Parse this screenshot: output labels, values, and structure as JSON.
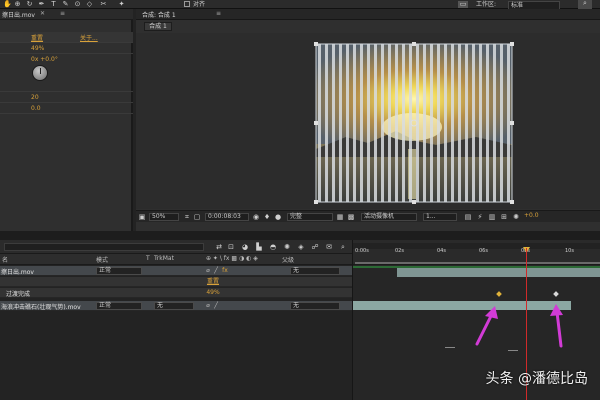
{
  "toolbar": {
    "checkbox_label": "对齐",
    "workspace_label": "工作区:",
    "workspace_value": "标准"
  },
  "effects_panel": {
    "tab_title": "擦日出.mov",
    "col_reset": "重置",
    "col_about": "关于...",
    "values": [
      "49%",
      "0x +0.0°",
      "20",
      "0.0"
    ]
  },
  "comp_panel": {
    "tab_title": "合成: 合成 1",
    "sub_tab": "合成 1",
    "zoom": "50%",
    "timecode": "0:00:08:03",
    "resolution": "完整",
    "camera": "活动摄像机",
    "views": "1...",
    "exposure": "+0.0"
  },
  "timeline": {
    "col_name": "名",
    "col_mode": "模式",
    "col_t": "T",
    "col_trkmat": "TrkMat",
    "col_parent": "父级",
    "layers": [
      {
        "name": "擦日出.mov",
        "mode": "正常",
        "trkmat": "",
        "parent": "无"
      },
      {
        "name": "",
        "mode": "",
        "trkmat": "",
        "parent": "",
        "reset": "重置",
        "value": "49%"
      },
      {
        "name": "过渡完成",
        "mode": "",
        "trkmat": "",
        "parent": ""
      },
      {
        "name": "海浪冲击礁石(壮观气势).mov",
        "mode": "正常",
        "trkmat": "无",
        "parent": "无"
      }
    ],
    "ruler_labels": [
      "0:00s",
      "02s",
      "04s",
      "06s",
      "08s",
      "10s"
    ]
  },
  "colors": {
    "accent_orange": "#d9a23a",
    "playhead": "#d02a2a",
    "layer_bar_1": "#7f9593",
    "layer_bar_2": "#8ba8a3",
    "arrow": "#d23bd6"
  },
  "watermark": "头条 @潘德比岛"
}
